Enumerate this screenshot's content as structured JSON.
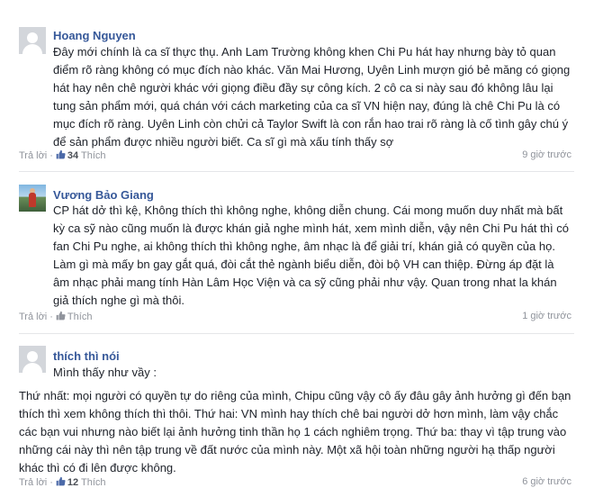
{
  "comments": [
    {
      "author": "Hoang Nguyen",
      "avatar": "default-avatar",
      "text": "Đây mới chính là ca sĩ thực thụ. Anh Lam Trường không khen Chi Pu hát hay nhưng bày tỏ quan điểm rõ ràng không có mục đích nào khác. Văn Mai Hương, Uyên Linh mượn gió bẻ măng có giọng hát hay nên chê người khác với giọng điều đầy sự công kích. 2 cô ca si này sau đó không lâu lại tung sản phẩm mới, quá chán với cách marketing của ca sĩ VN hiện nay, đúng là chê Chi Pu là có mục đích rõ ràng. Uyên Linh còn chửi cả Taylor Swift là con rắn hao trai rõ ràng là cố tình gây chú ý để sản phẩm được nhiều người biết. Ca sĩ gì mà xấu tính thấy sợ",
      "reply_label": "Trả lời",
      "like_count": "34",
      "like_label": "Thích",
      "time": "9 giờ trước"
    },
    {
      "author": "Vương Bảo Giang",
      "avatar": "photo-avatar",
      "text": "CP hát dở thì kệ, Không thích thì không nghe, không diễn chung. Cái mong muốn duy nhất mà bất kỳ ca sỹ nào cũng muốn là được khán giả nghe mình hát, xem mình diễn, vậy nên Chi Pu hát thì có fan Chi Pu nghe, ai không thích thì không nghe, âm nhạc là để giải trí, khán giả có quyền của họ. Làm gì mà mấy bn gay gắt quá, đòi cắt thẻ ngành biểu diễn, đòi bộ VH can thiệp. Đừng áp đặt là âm nhạc phải mang tính Hàn Lâm Học Viện và ca sỹ cũng phải như vậy. Quan trong nhat la khán giả thích nghe gì mà thôi.",
      "reply_label": "Trả lời",
      "like_count": "",
      "like_label": "Thích",
      "time": "1 giờ trước"
    },
    {
      "author": "thích thì nói",
      "avatar": "default-avatar",
      "first_line": "Mình thấy như vầy :",
      "text": "Thứ nhất: mọi người có quyền tự do riêng của mình, Chipu cũng vậy cô ấy đâu gây ảnh hưởng gì đến bạn thích thì xem không thích thì thôi. Thứ hai: VN mình hay thích chê bai người dở hơn mình, làm vậy chắc các bạn vui nhưng nào biết lại ảnh hưởng tinh thần họ 1 cách nghiêm trọng. Thứ ba: thay vì tập trung vào những cái này thì nên tập trung về đất nước của mình này. Một xã hội toàn những người hạ thấp người khác thì có đi lên được không.",
      "reply_label": "Trả lời",
      "like_count": "12",
      "like_label": "Thích",
      "time": "6 giờ trước"
    }
  ],
  "colors": {
    "author": "#365899",
    "text": "#1d2129",
    "meta": "#90949c",
    "divider": "#e5e6e9"
  }
}
